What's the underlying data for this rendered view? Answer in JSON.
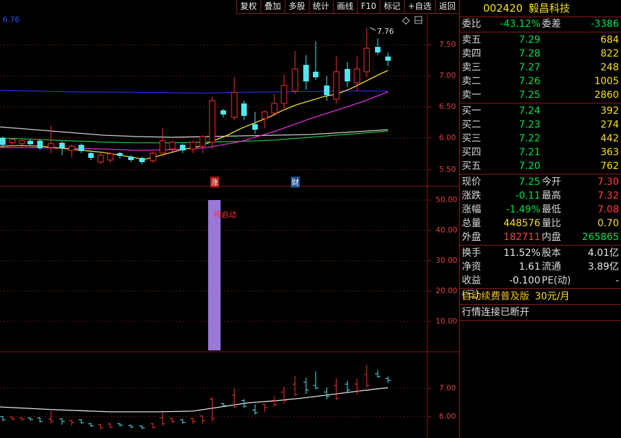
{
  "toolbar": {
    "buttons": [
      "复权",
      "叠加",
      "多股",
      "统计",
      "画线",
      "F10",
      "标记",
      "+自选",
      "返回"
    ]
  },
  "main_chart": {
    "ma_label": "6.76",
    "high_label": "7.76",
    "y_ticks": [
      "7.50",
      "7.00",
      "6.50",
      "6.00",
      "5.50"
    ],
    "marker_zhang": "涨",
    "marker_cai": "财"
  },
  "indicator_panel": {
    "y_ticks": [
      "50.00",
      "40.00",
      "30.00",
      "20.00",
      "10.00"
    ],
    "annotation": "将启动",
    "bar_value": 50,
    "bar_color": "#9a78d8"
  },
  "volume_panel": {
    "y_ticks": [
      "7.00",
      "6.00"
    ]
  },
  "quote": {
    "code": "002420",
    "name": "毅昌科技",
    "weibi_label": "委比",
    "weibi": "-43.12%",
    "weicha_label": "委差",
    "weicha": "-3386",
    "sell": [
      {
        "label": "卖五",
        "price": "7.29",
        "vol": "684"
      },
      {
        "label": "卖四",
        "price": "7.28",
        "vol": "822"
      },
      {
        "label": "卖三",
        "price": "7.27",
        "vol": "248"
      },
      {
        "label": "卖二",
        "price": "7.26",
        "vol": "1005"
      },
      {
        "label": "卖一",
        "price": "7.25",
        "vol": "2860"
      }
    ],
    "buy": [
      {
        "label": "买一",
        "price": "7.24",
        "vol": "392"
      },
      {
        "label": "买二",
        "price": "7.23",
        "vol": "274"
      },
      {
        "label": "买三",
        "price": "7.22",
        "vol": "442"
      },
      {
        "label": "买四",
        "price": "7.21",
        "vol": "363"
      },
      {
        "label": "买五",
        "price": "7.20",
        "vol": "762"
      }
    ],
    "stats": [
      {
        "l1": "现价",
        "v1": "7.25",
        "c1": "g",
        "l2": "今开",
        "v2": "7.30",
        "c2": "r"
      },
      {
        "l1": "涨跌",
        "v1": "-0.11",
        "c1": "g",
        "l2": "最高",
        "v2": "7.32",
        "c2": "r"
      },
      {
        "l1": "涨幅",
        "v1": "-1.49%",
        "c1": "g",
        "l2": "最低",
        "v2": "7.08",
        "c2": "r"
      },
      {
        "l1": "总量",
        "v1": "448576",
        "c1": "y",
        "l2": "量比",
        "v2": "0.70",
        "c2": "y"
      },
      {
        "l1": "外盘",
        "v1": "182711",
        "c1": "r",
        "l2": "内盘",
        "v2": "265865",
        "c2": "g"
      }
    ],
    "stats2": [
      {
        "l1": "换手",
        "v1": "11.52%",
        "l2": "股本",
        "v2": "4.01亿"
      },
      {
        "l1": "净资",
        "v1": "1.61",
        "l2": "流通",
        "v2": "3.89亿"
      },
      {
        "l1": "收益(三)",
        "v1": "-0.100",
        "l2": "PE(动)",
        "v2": "-"
      }
    ],
    "promo": "自动续费普及版",
    "promo_price": "30元/月",
    "status": "行情连接已断开"
  }
}
